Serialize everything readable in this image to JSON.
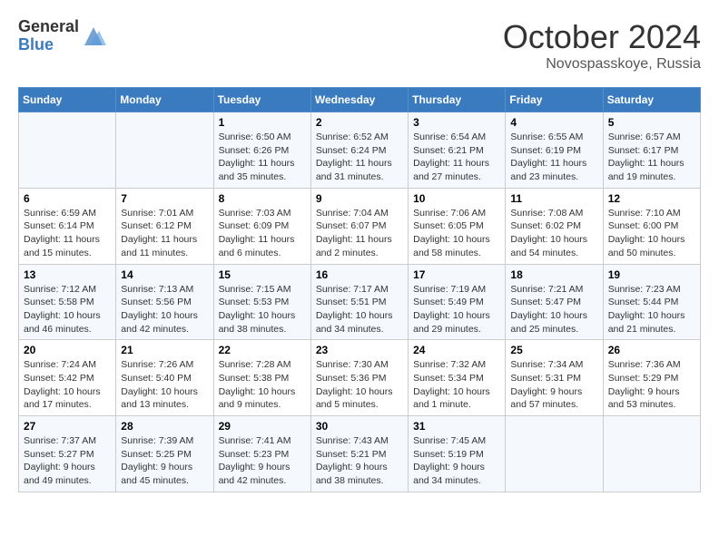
{
  "header": {
    "logo_general": "General",
    "logo_blue": "Blue",
    "month_title": "October 2024",
    "location": "Novospasskoye, Russia"
  },
  "days_of_week": [
    "Sunday",
    "Monday",
    "Tuesday",
    "Wednesday",
    "Thursday",
    "Friday",
    "Saturday"
  ],
  "weeks": [
    [
      {
        "day": "",
        "sunrise": "",
        "sunset": "",
        "daylight": ""
      },
      {
        "day": "",
        "sunrise": "",
        "sunset": "",
        "daylight": ""
      },
      {
        "day": "1",
        "sunrise": "Sunrise: 6:50 AM",
        "sunset": "Sunset: 6:26 PM",
        "daylight": "Daylight: 11 hours and 35 minutes."
      },
      {
        "day": "2",
        "sunrise": "Sunrise: 6:52 AM",
        "sunset": "Sunset: 6:24 PM",
        "daylight": "Daylight: 11 hours and 31 minutes."
      },
      {
        "day": "3",
        "sunrise": "Sunrise: 6:54 AM",
        "sunset": "Sunset: 6:21 PM",
        "daylight": "Daylight: 11 hours and 27 minutes."
      },
      {
        "day": "4",
        "sunrise": "Sunrise: 6:55 AM",
        "sunset": "Sunset: 6:19 PM",
        "daylight": "Daylight: 11 hours and 23 minutes."
      },
      {
        "day": "5",
        "sunrise": "Sunrise: 6:57 AM",
        "sunset": "Sunset: 6:17 PM",
        "daylight": "Daylight: 11 hours and 19 minutes."
      }
    ],
    [
      {
        "day": "6",
        "sunrise": "Sunrise: 6:59 AM",
        "sunset": "Sunset: 6:14 PM",
        "daylight": "Daylight: 11 hours and 15 minutes."
      },
      {
        "day": "7",
        "sunrise": "Sunrise: 7:01 AM",
        "sunset": "Sunset: 6:12 PM",
        "daylight": "Daylight: 11 hours and 11 minutes."
      },
      {
        "day": "8",
        "sunrise": "Sunrise: 7:03 AM",
        "sunset": "Sunset: 6:09 PM",
        "daylight": "Daylight: 11 hours and 6 minutes."
      },
      {
        "day": "9",
        "sunrise": "Sunrise: 7:04 AM",
        "sunset": "Sunset: 6:07 PM",
        "daylight": "Daylight: 11 hours and 2 minutes."
      },
      {
        "day": "10",
        "sunrise": "Sunrise: 7:06 AM",
        "sunset": "Sunset: 6:05 PM",
        "daylight": "Daylight: 10 hours and 58 minutes."
      },
      {
        "day": "11",
        "sunrise": "Sunrise: 7:08 AM",
        "sunset": "Sunset: 6:02 PM",
        "daylight": "Daylight: 10 hours and 54 minutes."
      },
      {
        "day": "12",
        "sunrise": "Sunrise: 7:10 AM",
        "sunset": "Sunset: 6:00 PM",
        "daylight": "Daylight: 10 hours and 50 minutes."
      }
    ],
    [
      {
        "day": "13",
        "sunrise": "Sunrise: 7:12 AM",
        "sunset": "Sunset: 5:58 PM",
        "daylight": "Daylight: 10 hours and 46 minutes."
      },
      {
        "day": "14",
        "sunrise": "Sunrise: 7:13 AM",
        "sunset": "Sunset: 5:56 PM",
        "daylight": "Daylight: 10 hours and 42 minutes."
      },
      {
        "day": "15",
        "sunrise": "Sunrise: 7:15 AM",
        "sunset": "Sunset: 5:53 PM",
        "daylight": "Daylight: 10 hours and 38 minutes."
      },
      {
        "day": "16",
        "sunrise": "Sunrise: 7:17 AM",
        "sunset": "Sunset: 5:51 PM",
        "daylight": "Daylight: 10 hours and 34 minutes."
      },
      {
        "day": "17",
        "sunrise": "Sunrise: 7:19 AM",
        "sunset": "Sunset: 5:49 PM",
        "daylight": "Daylight: 10 hours and 29 minutes."
      },
      {
        "day": "18",
        "sunrise": "Sunrise: 7:21 AM",
        "sunset": "Sunset: 5:47 PM",
        "daylight": "Daylight: 10 hours and 25 minutes."
      },
      {
        "day": "19",
        "sunrise": "Sunrise: 7:23 AM",
        "sunset": "Sunset: 5:44 PM",
        "daylight": "Daylight: 10 hours and 21 minutes."
      }
    ],
    [
      {
        "day": "20",
        "sunrise": "Sunrise: 7:24 AM",
        "sunset": "Sunset: 5:42 PM",
        "daylight": "Daylight: 10 hours and 17 minutes."
      },
      {
        "day": "21",
        "sunrise": "Sunrise: 7:26 AM",
        "sunset": "Sunset: 5:40 PM",
        "daylight": "Daylight: 10 hours and 13 minutes."
      },
      {
        "day": "22",
        "sunrise": "Sunrise: 7:28 AM",
        "sunset": "Sunset: 5:38 PM",
        "daylight": "Daylight: 10 hours and 9 minutes."
      },
      {
        "day": "23",
        "sunrise": "Sunrise: 7:30 AM",
        "sunset": "Sunset: 5:36 PM",
        "daylight": "Daylight: 10 hours and 5 minutes."
      },
      {
        "day": "24",
        "sunrise": "Sunrise: 7:32 AM",
        "sunset": "Sunset: 5:34 PM",
        "daylight": "Daylight: 10 hours and 1 minute."
      },
      {
        "day": "25",
        "sunrise": "Sunrise: 7:34 AM",
        "sunset": "Sunset: 5:31 PM",
        "daylight": "Daylight: 9 hours and 57 minutes."
      },
      {
        "day": "26",
        "sunrise": "Sunrise: 7:36 AM",
        "sunset": "Sunset: 5:29 PM",
        "daylight": "Daylight: 9 hours and 53 minutes."
      }
    ],
    [
      {
        "day": "27",
        "sunrise": "Sunrise: 7:37 AM",
        "sunset": "Sunset: 5:27 PM",
        "daylight": "Daylight: 9 hours and 49 minutes."
      },
      {
        "day": "28",
        "sunrise": "Sunrise: 7:39 AM",
        "sunset": "Sunset: 5:25 PM",
        "daylight": "Daylight: 9 hours and 45 minutes."
      },
      {
        "day": "29",
        "sunrise": "Sunrise: 7:41 AM",
        "sunset": "Sunset: 5:23 PM",
        "daylight": "Daylight: 9 hours and 42 minutes."
      },
      {
        "day": "30",
        "sunrise": "Sunrise: 7:43 AM",
        "sunset": "Sunset: 5:21 PM",
        "daylight": "Daylight: 9 hours and 38 minutes."
      },
      {
        "day": "31",
        "sunrise": "Sunrise: 7:45 AM",
        "sunset": "Sunset: 5:19 PM",
        "daylight": "Daylight: 9 hours and 34 minutes."
      },
      {
        "day": "",
        "sunrise": "",
        "sunset": "",
        "daylight": ""
      },
      {
        "day": "",
        "sunrise": "",
        "sunset": "",
        "daylight": ""
      }
    ]
  ]
}
